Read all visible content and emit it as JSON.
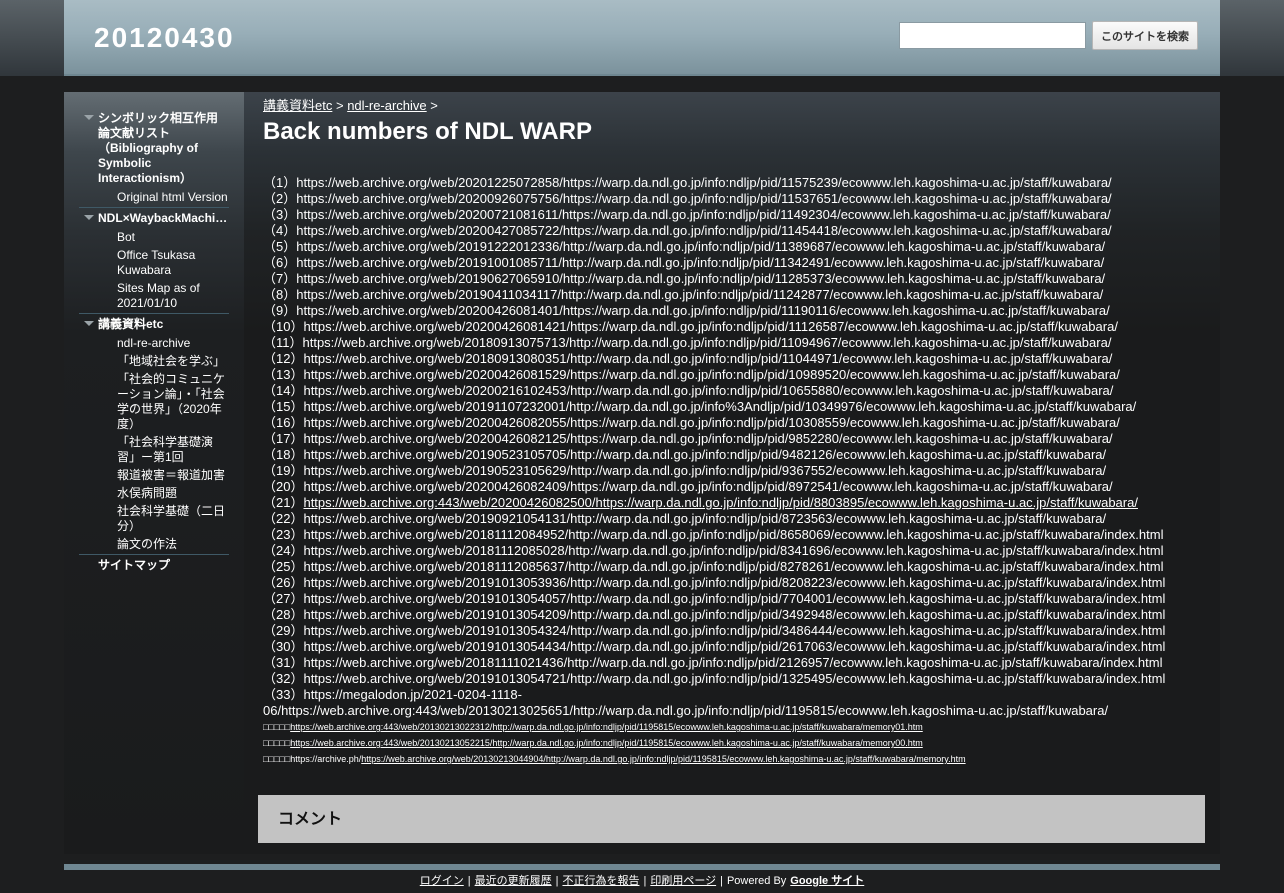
{
  "header": {
    "site_title": "20120430",
    "search_placeholder": "",
    "search_button": "このサイトを検索"
  },
  "sidebar": {
    "groups": [
      {
        "label": "シンボリック相互作用論文献リスト（Bibliography of Symbolic Interactionism）",
        "children": [
          "Original html Version"
        ]
      },
      {
        "label": "NDL×WaybackMachine",
        "children": [
          "Bot",
          "Office Tsukasa Kuwabara",
          "Sites Map as of 2021/01/10"
        ]
      },
      {
        "label": "講義資料etc",
        "children": [
          "ndl-re-archive",
          "「地域社会を学ぶ」",
          "「社会的コミュニケーション論」・「社会学の世界」（2020年度）",
          "「社会科学基礎演習」ー第1回",
          "報道被害＝報道加害",
          "水俣病問題",
          "社会科学基礎（二日分）",
          "論文の作法"
        ]
      }
    ],
    "sitemap": "サイトマップ"
  },
  "main": {
    "breadcrumb": [
      "講義資料etc",
      "ndl-re-archive"
    ],
    "breadcrumb_sep": ">",
    "title": "Back numbers of NDL WARP",
    "lines": [
      "（1）https://web.archive.org/web/20201225072858/https://warp.da.ndl.go.jp/info:ndljp/pid/11575239/ecowww.leh.kagoshima-u.ac.jp/staff/kuwabara/",
      "（2）https://web.archive.org/web/20200926075756/https://warp.da.ndl.go.jp/info:ndljp/pid/11537651/ecowww.leh.kagoshima-u.ac.jp/staff/kuwabara/",
      "（3）https://web.archive.org/web/20200721081611/https://warp.da.ndl.go.jp/info:ndljp/pid/11492304/ecowww.leh.kagoshima-u.ac.jp/staff/kuwabara/",
      "（4）https://web.archive.org/web/20200427085722/https://warp.da.ndl.go.jp/info:ndljp/pid/11454418/ecowww.leh.kagoshima-u.ac.jp/staff/kuwabara/",
      "（5）https://web.archive.org/web/20191222012336/http://warp.da.ndl.go.jp/info:ndljp/pid/11389687/ecowww.leh.kagoshima-u.ac.jp/staff/kuwabara/",
      "（6）https://web.archive.org/web/20191001085711/http://warp.da.ndl.go.jp/info:ndljp/pid/11342491/ecowww.leh.kagoshima-u.ac.jp/staff/kuwabara/",
      "（7）https://web.archive.org/web/20190627065910/http://warp.da.ndl.go.jp/info:ndljp/pid/11285373/ecowww.leh.kagoshima-u.ac.jp/staff/kuwabara/",
      "（8）https://web.archive.org/web/20190411034117/http://warp.da.ndl.go.jp/info:ndljp/pid/11242877/ecowww.leh.kagoshima-u.ac.jp/staff/kuwabara/",
      "（9）https://web.archive.org/web/20200426081401/https://warp.da.ndl.go.jp/info:ndljp/pid/11190116/ecowww.leh.kagoshima-u.ac.jp/staff/kuwabara/",
      "（10）https://web.archive.org/web/20200426081421/https://warp.da.ndl.go.jp/info:ndljp/pid/11126587/ecowww.leh.kagoshima-u.ac.jp/staff/kuwabara/",
      "（11）https://web.archive.org/web/20180913075713/http://warp.da.ndl.go.jp/info:ndljp/pid/11094967/ecowww.leh.kagoshima-u.ac.jp/staff/kuwabara/",
      "（12）https://web.archive.org/web/20180913080351/http://warp.da.ndl.go.jp/info:ndljp/pid/11044971/ecowww.leh.kagoshima-u.ac.jp/staff/kuwabara/",
      "（13）https://web.archive.org/web/20200426081529/https://warp.da.ndl.go.jp/info:ndljp/pid/10989520/ecowww.leh.kagoshima-u.ac.jp/staff/kuwabara/",
      "（14）https://web.archive.org/web/20200216102453/http://warp.da.ndl.go.jp/info:ndljp/pid/10655880/ecowww.leh.kagoshima-u.ac.jp/staff/kuwabara/",
      "（15）https://web.archive.org/web/20191107232001/http://warp.da.ndl.go.jp/info%3Andljp/pid/10349976/ecowww.leh.kagoshima-u.ac.jp/staff/kuwabara/",
      "（16）https://web.archive.org/web/20200426082055/https://warp.da.ndl.go.jp/info:ndljp/pid/10308559/ecowww.leh.kagoshima-u.ac.jp/staff/kuwabara/",
      "（17）https://web.archive.org/web/20200426082125/https://warp.da.ndl.go.jp/info:ndljp/pid/9852280/ecowww.leh.kagoshima-u.ac.jp/staff/kuwabara/",
      "（18）https://web.archive.org/web/20190523105705/http://warp.da.ndl.go.jp/info:ndljp/pid/9482126/ecowww.leh.kagoshima-u.ac.jp/staff/kuwabara/",
      "（19）https://web.archive.org/web/20190523105629/http://warp.da.ndl.go.jp/info:ndljp/pid/9367552/ecowww.leh.kagoshima-u.ac.jp/staff/kuwabara/",
      "（20）https://web.archive.org/web/20200426082409/https://warp.da.ndl.go.jp/info:ndljp/pid/8972541/ecowww.leh.kagoshima-u.ac.jp/staff/kuwabara/"
    ],
    "line21_prefix": "（21）",
    "line21_link": "https://web.archive.org:443/web/20200426082500/https://warp.da.ndl.go.jp/info:ndljp/pid/8803895/ecowww.leh.kagoshima-u.ac.jp/staff/kuwabara/",
    "lines_b": [
      "（22）https://web.archive.org/web/20190921054131/http://warp.da.ndl.go.jp/info:ndljp/pid/8723563/ecowww.leh.kagoshima-u.ac.jp/staff/kuwabara/",
      "（23）https://web.archive.org/web/20181112084952/http://warp.da.ndl.go.jp/info:ndljp/pid/8658069/ecowww.leh.kagoshima-u.ac.jp/staff/kuwabara/index.html",
      "（24）https://web.archive.org/web/20181112085028/http://warp.da.ndl.go.jp/info:ndljp/pid/8341696/ecowww.leh.kagoshima-u.ac.jp/staff/kuwabara/index.html",
      "（25）https://web.archive.org/web/20181112085637/http://warp.da.ndl.go.jp/info:ndljp/pid/8278261/ecowww.leh.kagoshima-u.ac.jp/staff/kuwabara/index.html",
      "（26）https://web.archive.org/web/20191013053936/http://warp.da.ndl.go.jp/info:ndljp/pid/8208223/ecowww.leh.kagoshima-u.ac.jp/staff/kuwabara/index.html",
      "（27）https://web.archive.org/web/20191013054057/http://warp.da.ndl.go.jp/info:ndljp/pid/7704001/ecowww.leh.kagoshima-u.ac.jp/staff/kuwabara/index.html",
      "（28）https://web.archive.org/web/20191013054209/http://warp.da.ndl.go.jp/info:ndljp/pid/3492948/ecowww.leh.kagoshima-u.ac.jp/staff/kuwabara/index.html",
      "（29）https://web.archive.org/web/20191013054324/http://warp.da.ndl.go.jp/info:ndljp/pid/3486444/ecowww.leh.kagoshima-u.ac.jp/staff/kuwabara/index.html",
      "（30）https://web.archive.org/web/20191013054434/http://warp.da.ndl.go.jp/info:ndljp/pid/2617063/ecowww.leh.kagoshima-u.ac.jp/staff/kuwabara/index.html",
      "（31）https://web.archive.org/web/20181111021436/http://warp.da.ndl.go.jp/info:ndljp/pid/2126957/ecowww.leh.kagoshima-u.ac.jp/staff/kuwabara/index.html",
      "（32）https://web.archive.org/web/20191013054721/http://warp.da.ndl.go.jp/info:ndljp/pid/1325495/ecowww.leh.kagoshima-u.ac.jp/staff/kuwabara/index.html"
    ],
    "line33a": "（33）https://megalodon.jp/2021-0204-1118-",
    "line33b": "06/https://web.archive.org:443/web/20130213025651/http://warp.da.ndl.go.jp/info:ndljp/pid/1195815/ecowww.leh.kagoshima-u.ac.jp/staff/kuwabara/",
    "small_prefix": "□□□□□",
    "small1": "https://web.archive.org:443/web/20130213022312/http://warp.da.ndl.go.jp/info:ndljp/pid/1195815/ecowww.leh.kagoshima-u.ac.jp/staff/kuwabara/memory01.htm",
    "small2": "https://web.archive.org:443/web/20130213052215/http://warp.da.ndl.go.jp/info:ndljp/pid/1195815/ecowww.leh.kagoshima-u.ac.jp/staff/kuwabara/memory00.htm",
    "small3_plain": "https://archive.ph/",
    "small3_link": "https://web.archive.org/web/20130213044904/http://warp.da.ndl.go.jp/info:ndljp/pid/1195815/ecowww.leh.kagoshima-u.ac.jp/staff/kuwabara/memory.htm",
    "comment_title": "コメント"
  },
  "footer": {
    "login": "ログイン",
    "recent": "最近の更新履歴",
    "report": "不正行為を報告",
    "print": "印刷用ページ",
    "powered": "Powered By",
    "google": "Google サイト",
    "sep": "|"
  }
}
